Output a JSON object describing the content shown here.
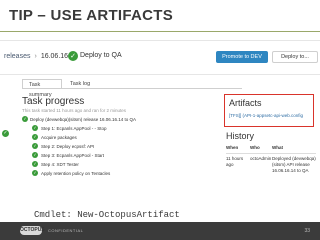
{
  "slide": {
    "title": "TIP – USE ARTIFACTS",
    "cmdlet": "Cmdlet: New-OctopusArtifact",
    "footer": {
      "logo_text": "OCTOPUS",
      "confidential": "CONFIDENTIAL",
      "page_number": "33"
    }
  },
  "release": {
    "breadcrumb_releases": "releases",
    "breadcrumb_sep": "›",
    "version": "16.06.16.14",
    "deploy_title": "Deploy to QA",
    "promote_button": "Promote to DEV",
    "deploy_button": "Deploy to..."
  },
  "tabs": [
    {
      "label": "Task summary",
      "active": true
    },
    {
      "label": "Task log",
      "active": false
    }
  ],
  "task": {
    "heading": "Task progress",
    "subline": "This task started 11 hours ago and ran for 2 minutes",
    "steps": [
      {
        "text": "Deploy (devwebqa)(sitsm) release 16.06.16.14 to QA",
        "level": "root"
      },
      {
        "text": "Step 1: Ecpanls AppPool - - Stop",
        "level": "child"
      },
      {
        "text": "Acquire packages",
        "level": "child"
      },
      {
        "text": "Step 2: Deploy ecpssf: API",
        "level": "child"
      },
      {
        "text": "Step 3: Ecpanls AppPool - Start",
        "level": "child"
      },
      {
        "text": "Step 4: XDT Tester",
        "level": "child"
      },
      {
        "text": "Apply retention policy on Tentacles",
        "level": "child"
      }
    ]
  },
  "artifacts": {
    "heading": "Artifacts",
    "link": "[TFS]] (API-1-appsetc-api-web.config"
  },
  "history": {
    "heading": "History",
    "columns": [
      "When",
      "Who",
      "What"
    ],
    "row": {
      "when": "11 hours ago",
      "who": "octoAdmin",
      "what": "Deployed (devwebqa)(sitsm) API release 16.06.16.14 to QA"
    }
  }
}
